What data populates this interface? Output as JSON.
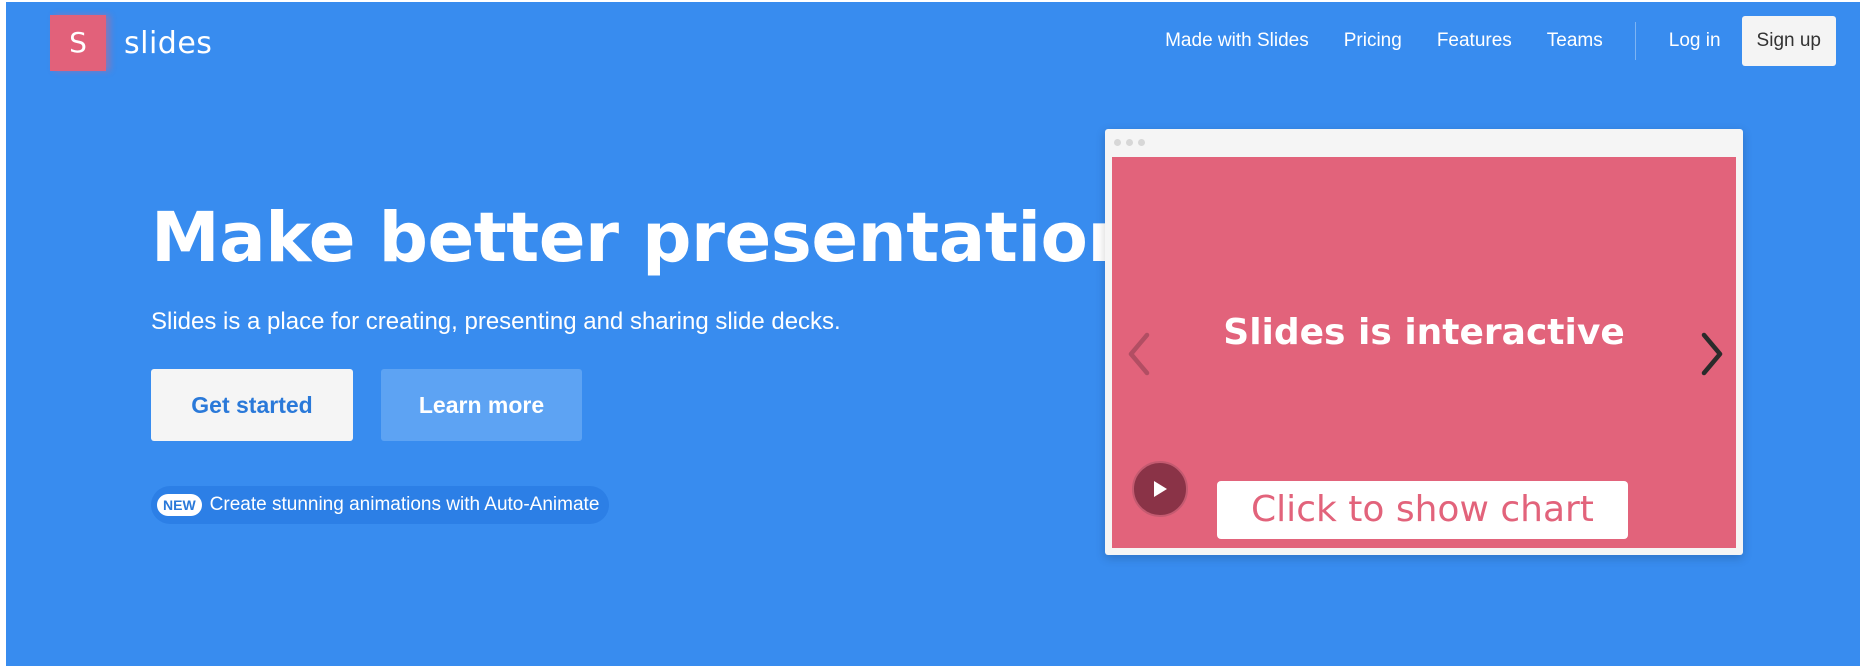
{
  "brand": {
    "logo_letter": "S",
    "name": "slides",
    "logo_color": "#e2617a"
  },
  "nav": {
    "items": [
      {
        "label": "Made with Slides"
      },
      {
        "label": "Pricing"
      },
      {
        "label": "Features"
      },
      {
        "label": "Teams"
      }
    ],
    "login_label": "Log in",
    "signup_label": "Sign up"
  },
  "hero": {
    "title": "Make better presentations",
    "subtitle": "Slides is a place for creating, presenting and sharing slide decks.",
    "primary_button": "Get started",
    "secondary_button": "Learn more",
    "announcement": {
      "badge": "NEW",
      "text": "Create stunning animations with Auto-Animate"
    },
    "background_color": "#388cef"
  },
  "preview": {
    "slide_title": "Slides is interactive",
    "slide_button": "Click to show chart",
    "slide_color": "#e2637b",
    "icons": {
      "prev": "chevron-left-icon",
      "next": "chevron-right-icon",
      "play": "play-icon"
    }
  }
}
